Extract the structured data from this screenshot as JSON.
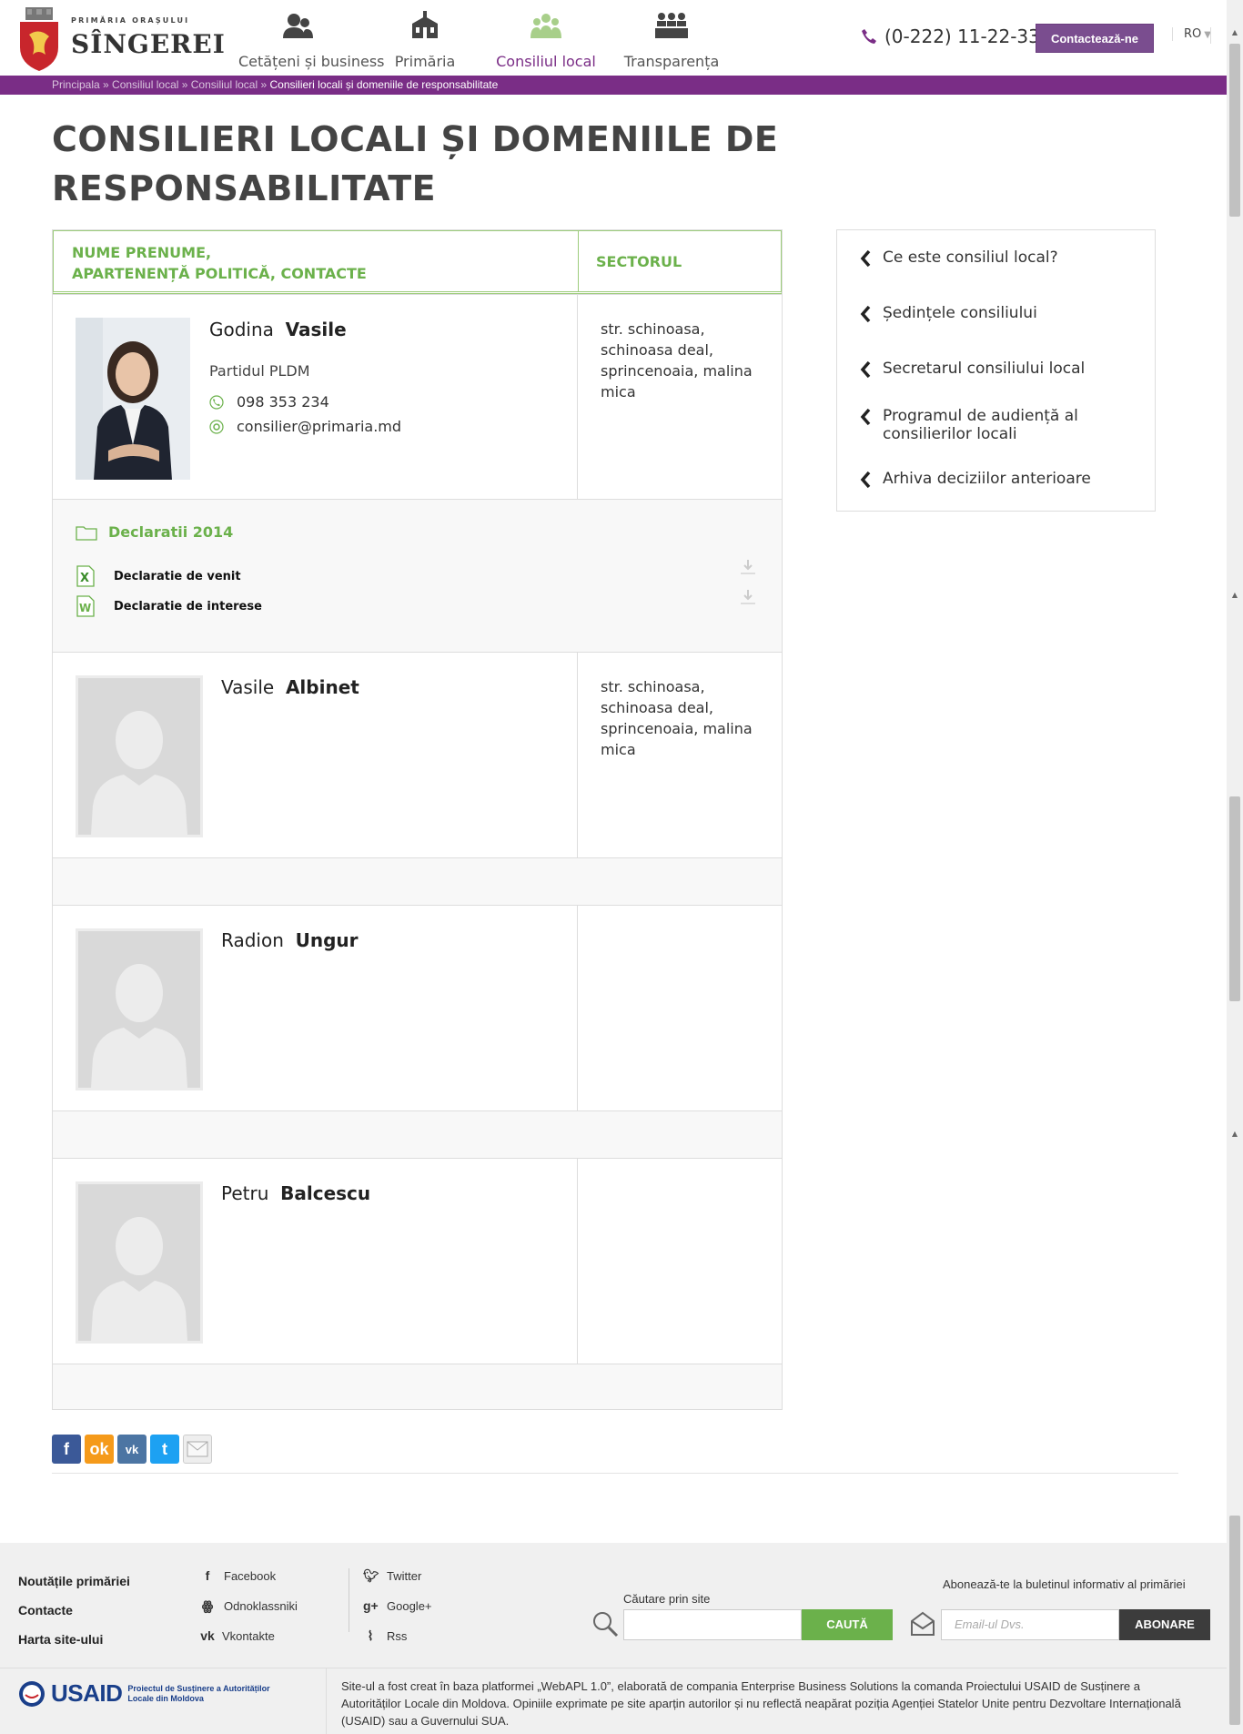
{
  "brand": {
    "sup": "PRIMĂRIA ORAȘULUI",
    "city": "SÎNGEREI"
  },
  "nav": [
    {
      "label": "Cetățeni și business",
      "icon": "people-icon"
    },
    {
      "label": "Primăria",
      "icon": "building-icon"
    },
    {
      "label": "Consiliul local",
      "icon": "council-icon",
      "active": true
    },
    {
      "label": "Transparența",
      "icon": "meeting-icon"
    }
  ],
  "header": {
    "phone": "(0-222) 11-22-33",
    "contact_label": "Contactează-ne",
    "lang": "RO"
  },
  "breadcrumb": {
    "items": [
      "Principala",
      "Consiliul local",
      "Consiliul local"
    ],
    "current": "Consilieri locali și domeniile de responsabilitate"
  },
  "page_title": "CONSILIERI LOCALI ȘI DOMENIILE DE RESPONSABILITATE",
  "table": {
    "col1_line1": "NUME PRENUME,",
    "col1_line2": "APARTENENȚĂ POLITICĂ, CONTACTE",
    "col2": "SECTORUL",
    "members": [
      {
        "first": "Godina",
        "last": "Vasile",
        "party": "Partidul PLDM",
        "phone": "098 353 234",
        "email": "consilier@primaria.md",
        "sector": "str. schinoasa, schinoasa deal, sprincenoaia, malina mica"
      },
      {
        "first": "Vasile",
        "last": "Albinet",
        "sector": "str. schinoasa, schinoasa deal, sprincenoaia, malina mica"
      },
      {
        "first": "Radion",
        "last": "Ungur"
      },
      {
        "first": "Petru",
        "last": "Balcescu"
      }
    ],
    "declarations": {
      "folder": "Declaratii 2014",
      "docs": [
        "Declaratie de venit",
        "Declaratie de interese"
      ]
    }
  },
  "sidebar": [
    "Ce este consiliul local?",
    "Ședințele consiliului",
    "Secretarul consiliului local",
    "Programul de audiență al consilierilor locali",
    "Arhiva deciziilor anterioare"
  ],
  "share": [
    "facebook",
    "odnoklassniki",
    "vkontakte",
    "twitter",
    "email"
  ],
  "footer": {
    "links": [
      "Noutățile primăriei",
      "Contacte",
      "Harta site-ului"
    ],
    "social_left": [
      "Facebook",
      "Odnoklassniki",
      "Vkontakte"
    ],
    "social_right": [
      "Twitter",
      "Google+",
      "Rss"
    ],
    "search_label": "Căutare prin site",
    "search_button": "CAUTĂ",
    "subscribe_label": "Abonează-te la buletinul informativ al primăriei",
    "email_placeholder": "Email-ul Dvs.",
    "subscribe_button": "ABONARE",
    "usaid": "USAID",
    "usaid_project": "Proiectul de Susținere a Autorităților Locale din Moldova",
    "credits": "Site-ul a fost creat în baza platformei „WebAPL 1.0”, elaborată de compania Enterprise Business Solutions la comanda Proiectului USAID de Susținere a Autorităților Locale din Moldova. Opiniile exprimate pe site aparțin autorilor și nu reflectă neapărat poziția Agenției Statelor Unite pentru Dezvoltare Internațională (USAID) sau a Guvernului SUA."
  },
  "colors": {
    "purple": "#7a2d86",
    "green": "#6bb14b"
  }
}
